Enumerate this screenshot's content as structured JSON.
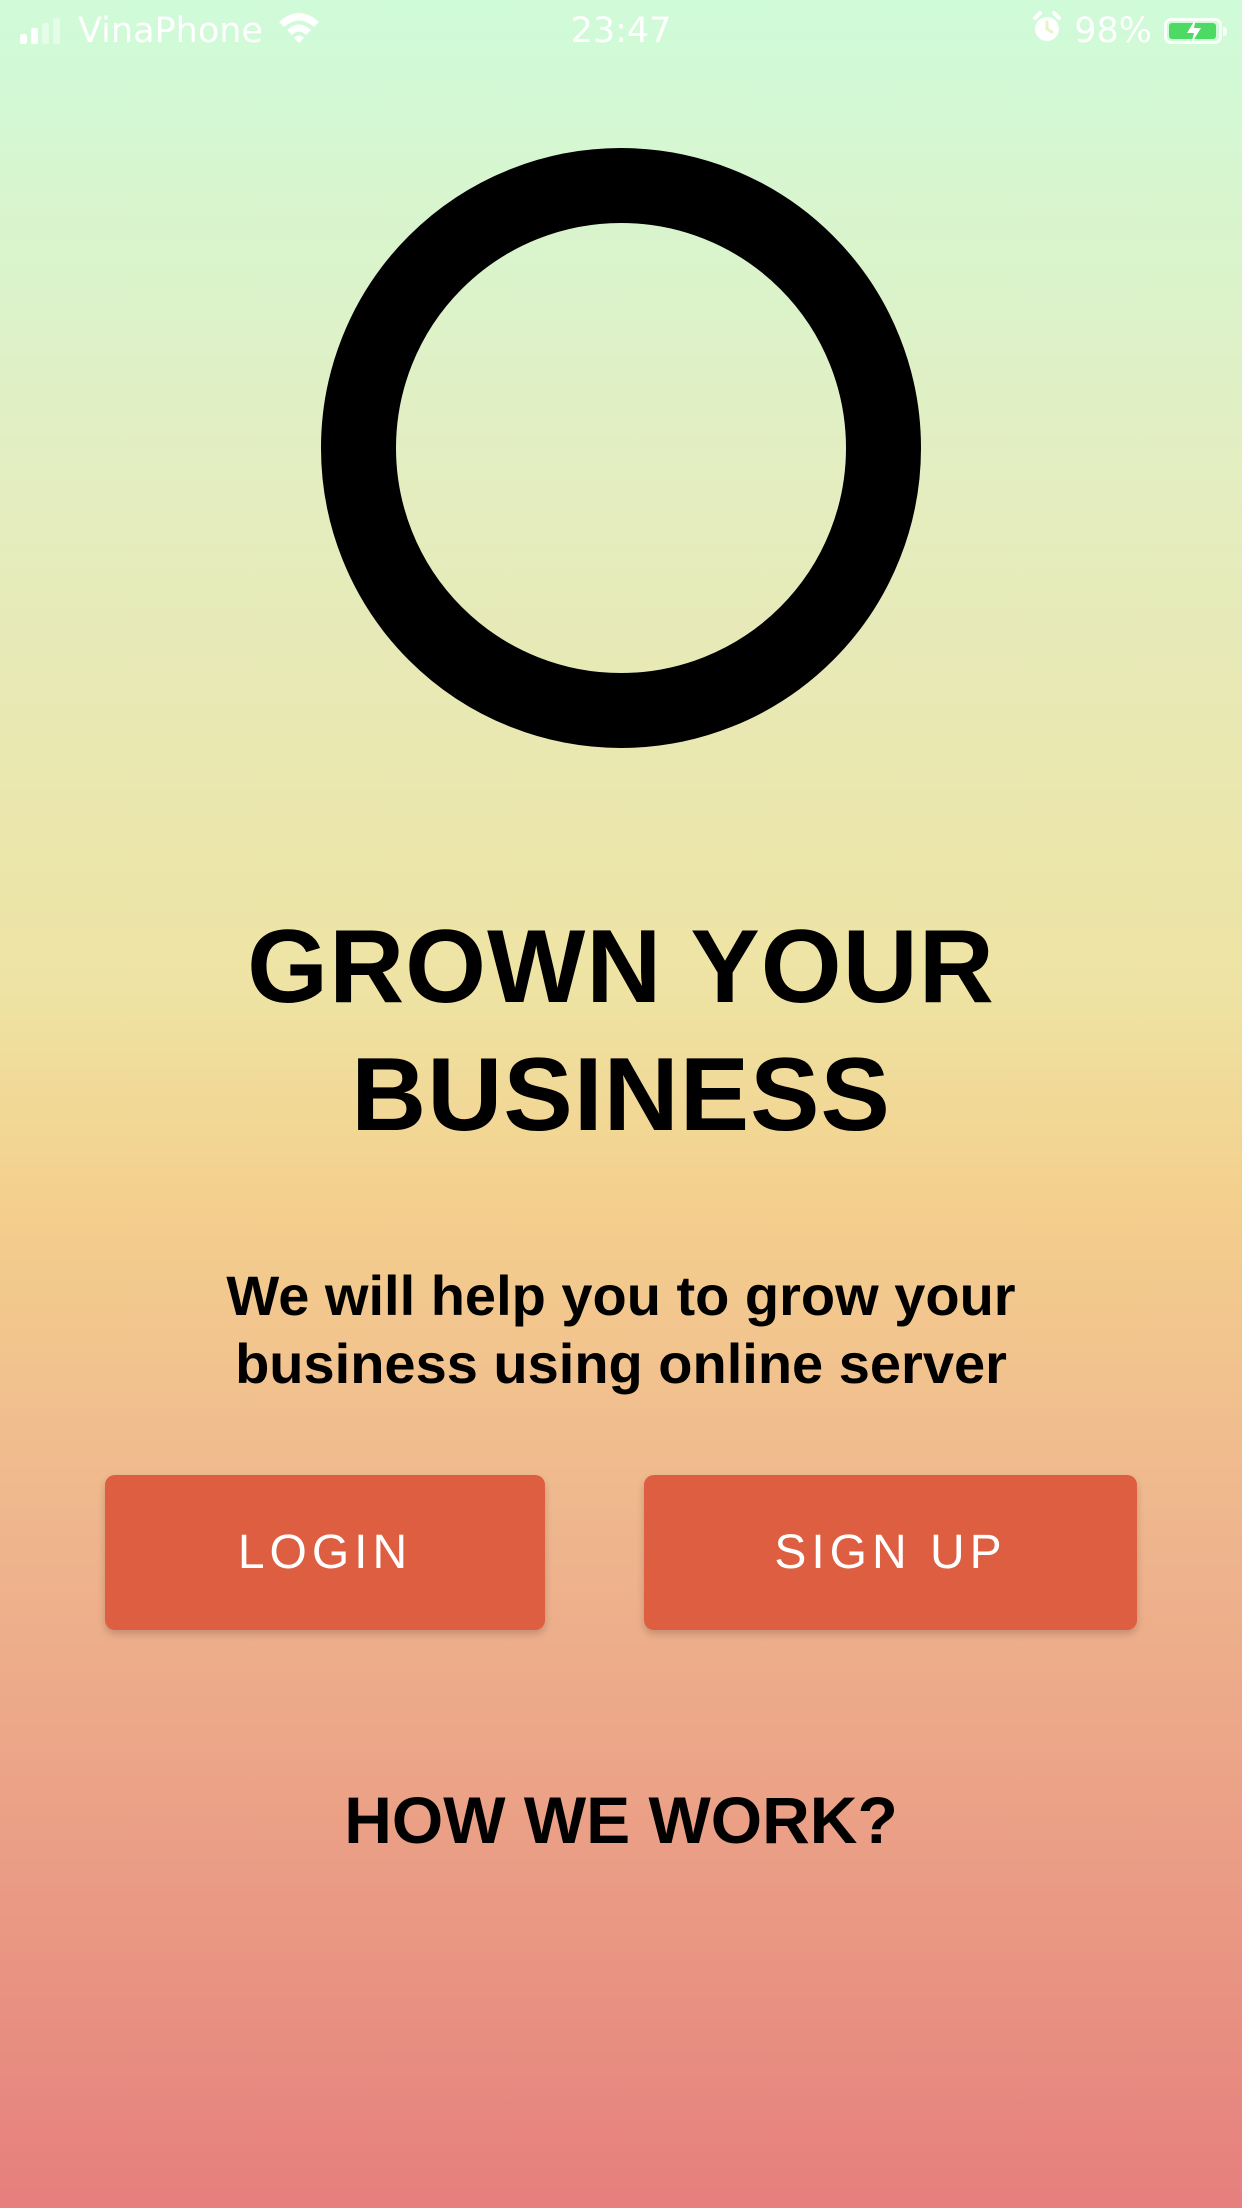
{
  "status_bar": {
    "carrier": "VinaPhone",
    "time": "23:47",
    "battery": "98%",
    "battery_level": 0.98,
    "signal_bars": 2,
    "icons": [
      "signal-icon",
      "wifi-icon",
      "alarm-icon",
      "battery-charging-icon"
    ]
  },
  "logo": {
    "icon": "ring-logo-icon",
    "color": "#000000"
  },
  "hero": {
    "title_line1": "GROWN YOUR",
    "title_line2": "BUSINESS",
    "subtitle_line1": "We will help you to grow your",
    "subtitle_line2": "business using online server"
  },
  "actions": {
    "login_label": "LOGIN",
    "signup_label": "SIGN UP",
    "button_color": "#dd5e40"
  },
  "footer": {
    "how_label": "HOW WE WORK?"
  },
  "background_gradient": [
    "#cffbd9",
    "#eee3a3",
    "#f4d08d",
    "#ea9c85",
    "#e67f7d"
  ]
}
